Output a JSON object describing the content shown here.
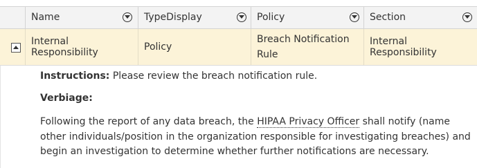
{
  "columns": [
    "Name",
    "TypeDisplay",
    "Policy",
    "Section"
  ],
  "row": {
    "name": "Internal Responsibility",
    "type_display": "Policy",
    "policy_line1": "Breach Notification",
    "policy_line2": "Rule",
    "section": "Internal Responsibility"
  },
  "detail": {
    "instructions_label": "Instructions:",
    "instructions_text": " Please review the breach notification rule.",
    "verbiage_label": "Verbiage:",
    "verbiage_pre": "Following the report of any data breach, the ",
    "verbiage_abbr": "HIPAA Privacy Officer",
    "verbiage_post": " shall notify (name other individuals/position in the organization responsible for investigating breaches) and begin an investigation to determine whether further notifications are necessary."
  },
  "icons": {
    "filter": "filter-icon",
    "collapse": "collapse-icon"
  },
  "colors": {
    "header_bg": "#f3f3f3",
    "selected_row_bg": "#fcf3d8",
    "border": "#d3d3d3"
  }
}
